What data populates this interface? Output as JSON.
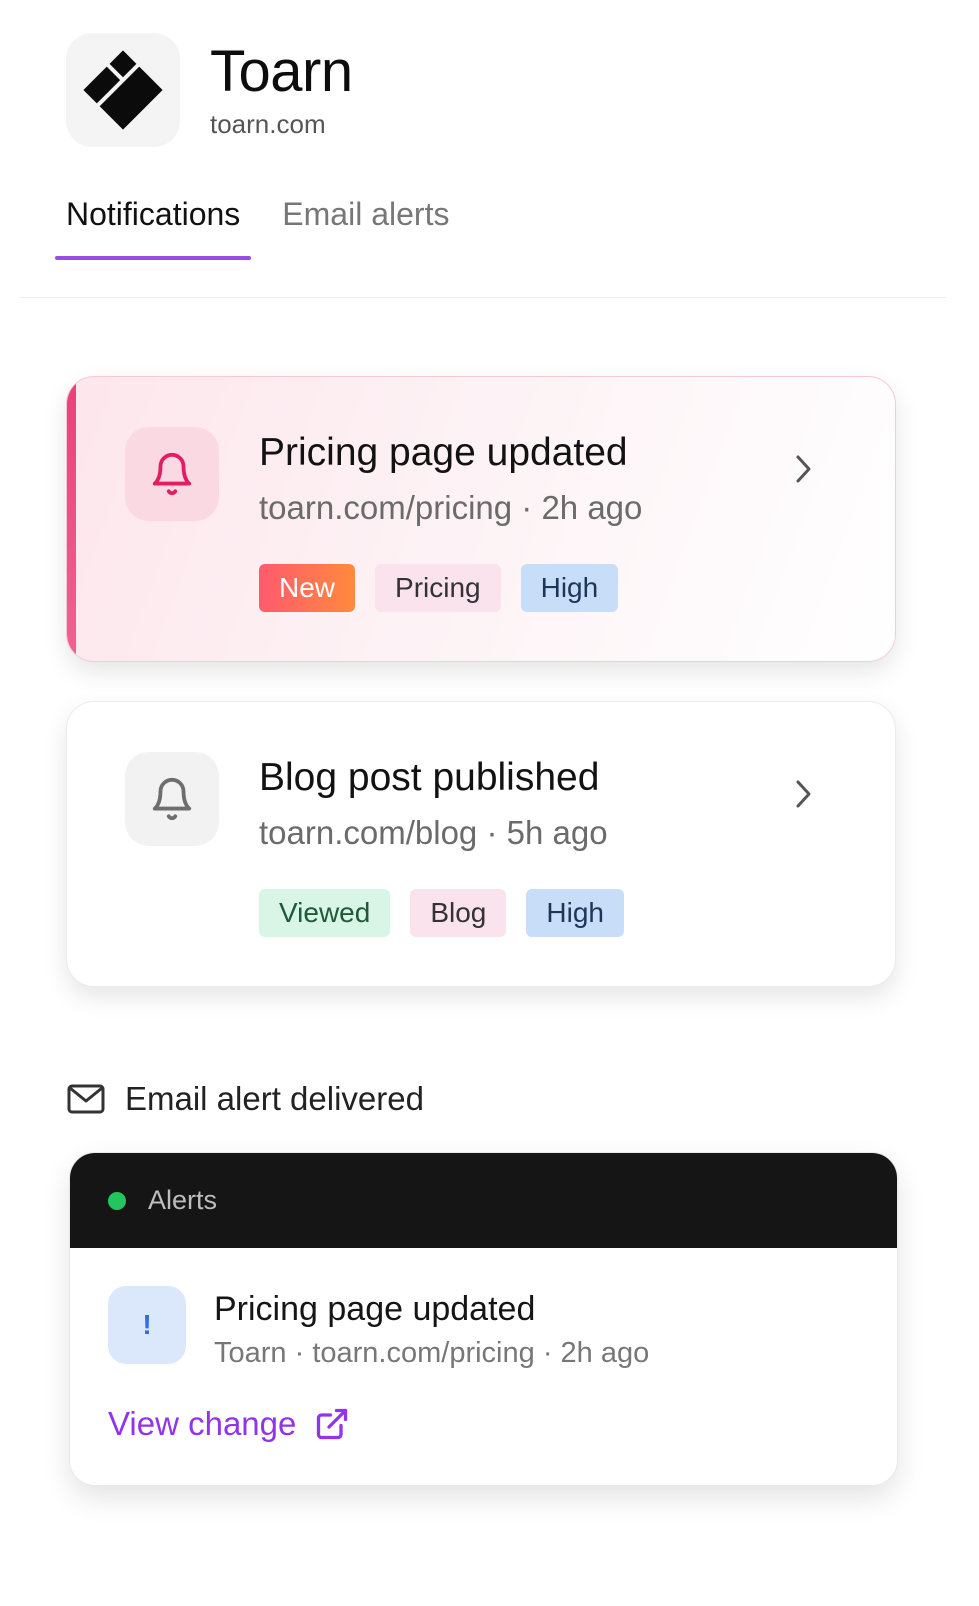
{
  "brand": {
    "name": "Toarn",
    "domain": "toarn.com"
  },
  "tabs": [
    {
      "label": "Notifications",
      "active": true
    },
    {
      "label": "Email alerts",
      "active": false
    }
  ],
  "notifications": [
    {
      "title": "Pricing page updated",
      "path": "toarn.com/pricing",
      "time": "2h ago",
      "tags": [
        "New",
        "Pricing",
        "High"
      ]
    },
    {
      "title": "Blog post published",
      "path": "toarn.com/blog",
      "time": "5h ago",
      "tags": [
        "Viewed",
        "Blog",
        "High"
      ]
    }
  ],
  "email": {
    "heading": "Email alert delivered",
    "channel": "Alerts",
    "item": {
      "badge": "!",
      "title": "Pricing page updated",
      "sender": "Toarn",
      "path": "toarn.com/pricing",
      "time": "2h ago"
    },
    "link_label": "View change"
  },
  "colors": {
    "accent": "#9b4ae8",
    "link": "#9333ea",
    "highlight_bar": "#ec407a",
    "status_dot": "#22c55e"
  },
  "icons": [
    "toarn-logo",
    "bell-icon",
    "chevron-right-icon",
    "mail-icon",
    "external-link-icon"
  ]
}
